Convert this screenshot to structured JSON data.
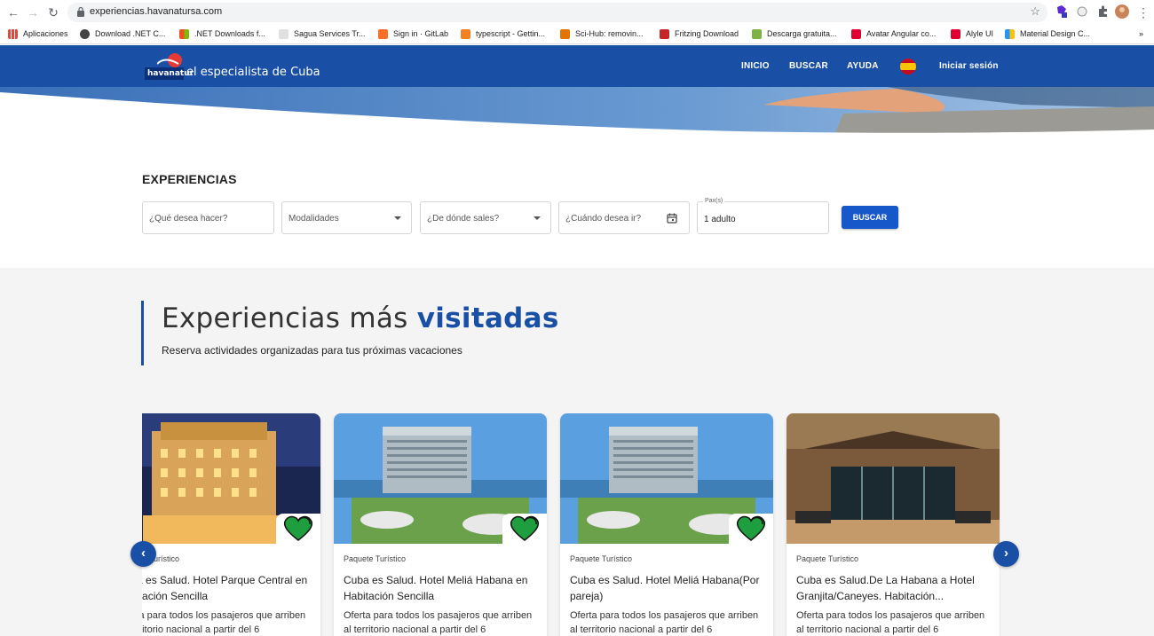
{
  "browser": {
    "url": "experiencias.havanatursa.com",
    "bookmarks": [
      {
        "label": "Aplicaciones",
        "color": "#e8453c"
      },
      {
        "label": "Download .NET C...",
        "color": "#444"
      },
      {
        "label": ".NET Downloads f...",
        "color": "#f25022"
      },
      {
        "label": "Sagua Services Tr...",
        "color": "#9aa0a6"
      },
      {
        "label": "Sign in · GitLab",
        "color": "#fc6d26"
      },
      {
        "label": "typescript - Gettin...",
        "color": "#f48024"
      },
      {
        "label": "Sci-Hub: removin...",
        "color": "#e37400"
      },
      {
        "label": "Fritzing Download",
        "color": "#c62828"
      },
      {
        "label": "Descarga gratuita...",
        "color": "#7cb342"
      },
      {
        "label": "Avatar Angular co...",
        "color": "#dd0031"
      },
      {
        "label": "Alyle UI",
        "color": "#dd0031"
      },
      {
        "label": "Material Design C...",
        "color": "#2196f3"
      }
    ],
    "more": "»"
  },
  "header": {
    "logo_text": "havanatur",
    "tagline": "el especialista de Cuba",
    "nav": [
      "INICIO",
      "BUSCAR",
      "AYUDA"
    ],
    "login": "Iniciar sesión",
    "color": "#1a4fa6"
  },
  "search": {
    "title": "EXPERIENCIAS",
    "what_placeholder": "¿Qué desea hacer?",
    "modality_placeholder": "Modalidades",
    "from_placeholder": "¿De dónde sales?",
    "when_placeholder": "¿Cuándo desea ir?",
    "pax_label": "Pax(s)",
    "pax_value": "1 adulto",
    "button": "BUSCAR",
    "button_color": "#1657c9"
  },
  "visited": {
    "title_part1": "Experiencias más",
    "title_part2": "visitadas",
    "subtitle": "Reserva actividades organizadas para tus próximas vacaciones",
    "prev": "‹",
    "next": "›",
    "cards": [
      {
        "type": "Paquete Turístico",
        "title": "Cuba es Salud. Hotel Parque Central en Habitación Sencilla",
        "desc": "Oferta para todos los pasajeros que arriben al territorio nacional a partir del 6"
      },
      {
        "type": "Paquete Turístico",
        "title": "Cuba es Salud. Hotel Meliá Habana en Habitación Sencilla",
        "desc": "Oferta para todos los pasajeros que arriben al territorio nacional a partir del 6"
      },
      {
        "type": "Paquete Turístico",
        "title": "Cuba es Salud. Hotel Meliá Habana(Por pareja)",
        "desc": "Oferta para todos los pasajeros que arriben al territorio nacional a partir del 6"
      },
      {
        "type": "Paquete Turístico",
        "title": "Cuba es Salud.De La Habana a Hotel Granjita/Caneyes. Habitación...",
        "desc": "Oferta para todos los pasajeros que arriben al territorio nacional a partir del 6"
      }
    ]
  }
}
